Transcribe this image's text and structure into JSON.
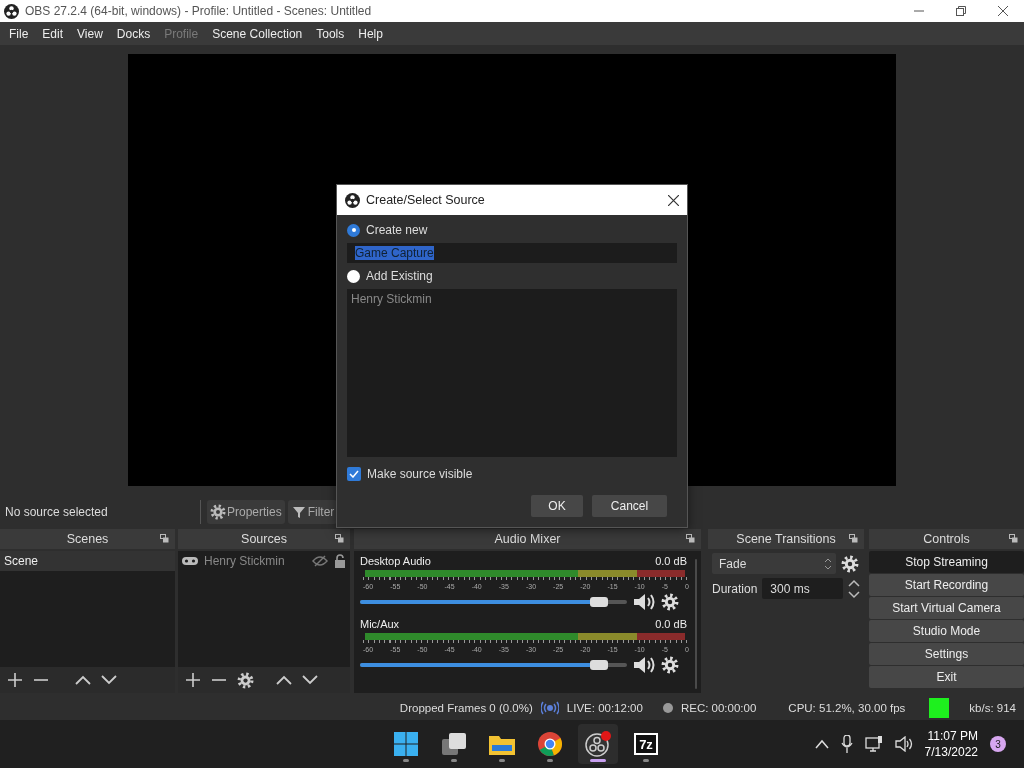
{
  "window": {
    "title": "OBS 27.2.4 (64-bit, windows) - Profile: Untitled - Scenes: Untitled"
  },
  "menu": [
    {
      "label": "File",
      "disabled": false
    },
    {
      "label": "Edit",
      "disabled": false
    },
    {
      "label": "View",
      "disabled": false
    },
    {
      "label": "Docks",
      "disabled": false
    },
    {
      "label": "Profile",
      "disabled": true
    },
    {
      "label": "Scene Collection",
      "disabled": false
    },
    {
      "label": "Tools",
      "disabled": false
    },
    {
      "label": "Help",
      "disabled": false
    }
  ],
  "source_toolbar": {
    "status": "No source selected",
    "buttons": [
      {
        "kind": "properties",
        "label": "Properties"
      },
      {
        "kind": "filters",
        "label": "Filter"
      }
    ]
  },
  "dialog": {
    "title": "Create/Select Source",
    "options": [
      {
        "label": "Create new",
        "selected": true
      },
      {
        "label": "Add Existing",
        "selected": false
      }
    ],
    "name_value": "Game Capture",
    "existing_sources": [
      "Henry Stickmin"
    ],
    "make_visible": {
      "label": "Make source visible",
      "checked": true
    },
    "buttons": [
      "OK",
      "Cancel"
    ]
  },
  "scenes": {
    "title": "Scenes",
    "items": [
      {
        "label": "Scene",
        "selected": true
      }
    ]
  },
  "sources": {
    "title": "Sources",
    "items": [
      {
        "label": "Henry Stickmin",
        "visible": false,
        "locked": false
      }
    ]
  },
  "audio_mixer": {
    "title": "Audio Mixer",
    "channels": [
      {
        "name": "Desktop Audio",
        "reading": "0.0 dB",
        "level": 0.93,
        "muted": false,
        "scale": [
          "-60",
          "-55",
          "-50",
          "-45",
          "-40",
          "-35",
          "-30",
          "-25",
          "-20",
          "-15",
          "-10",
          "-5",
          "0"
        ]
      },
      {
        "name": "Mic/Aux",
        "reading": "0.0 dB",
        "level": 0.93,
        "muted": false,
        "scale": [
          "-60",
          "-55",
          "-50",
          "-45",
          "-40",
          "-35",
          "-30",
          "-25",
          "-20",
          "-15",
          "-10",
          "-5",
          "0"
        ]
      }
    ]
  },
  "scene_transitions": {
    "title": "Scene Transitions",
    "transition": "Fade",
    "duration_label": "Duration",
    "duration": "300 ms"
  },
  "controls": {
    "title": "Controls",
    "buttons": [
      {
        "label": "Stop Streaming",
        "active": true
      },
      {
        "label": "Start Recording",
        "active": false
      },
      {
        "label": "Start Virtual Camera",
        "active": false
      },
      {
        "label": "Studio Mode",
        "active": false
      },
      {
        "label": "Settings",
        "active": false
      },
      {
        "label": "Exit",
        "active": false
      }
    ]
  },
  "status_bar": {
    "dropped": "Dropped Frames 0 (0.0%)",
    "live": "LIVE: 00:12:00",
    "rec": "REC: 00:00:00",
    "cpu": "CPU: 51.2%, 30.00 fps",
    "bitrate": "kb/s: 914"
  },
  "taskbar": {
    "apps": [
      {
        "kind": "start",
        "selected": false
      },
      {
        "kind": "task-view",
        "selected": false
      },
      {
        "kind": "files",
        "selected": false
      },
      {
        "kind": "browser",
        "selected": false
      },
      {
        "kind": "obs",
        "selected": true
      },
      {
        "kind": "archiver",
        "label": "7z",
        "selected": false
      }
    ],
    "time": "11:07 PM",
    "date": "7/13/2022",
    "notifications": "3"
  }
}
